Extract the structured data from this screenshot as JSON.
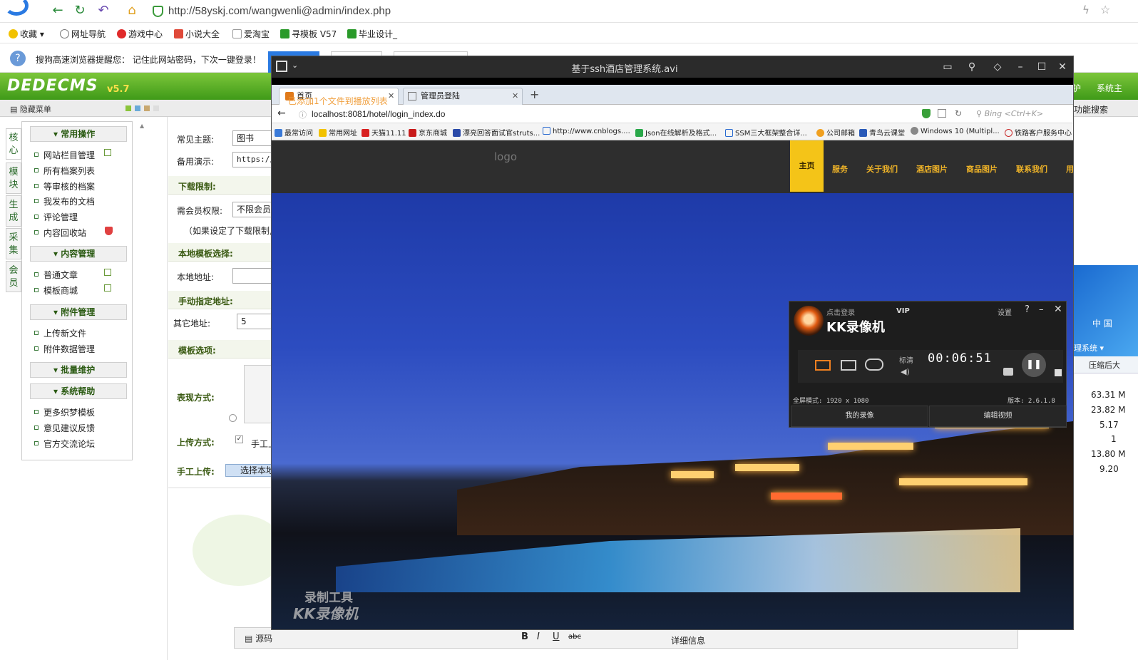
{
  "outer_browser": {
    "url": "http://58yskj.com/wangwenli@admin/index.php",
    "bookmarks": [
      "收藏",
      "网址导航",
      "游戏中心",
      "小说大全",
      "爱淘宝",
      "寻模板 V57",
      "毕业设计_"
    ],
    "notice": "搜狗高速浏览器提醒您：  记住此网站密码，下次一键登录！"
  },
  "dede": {
    "logo": "DEDECMS",
    "version": "v5.7",
    "hide_menu": "隐藏菜单",
    "left_tabs": [
      "核心",
      "模块",
      "生成",
      "采集",
      "会员"
    ],
    "menu_groups": [
      {
        "title": "常用操作",
        "items": [
          "网站栏目管理",
          "所有档案列表",
          "等审核的档案",
          "我发布的文档",
          "评论管理",
          "内容回收站"
        ]
      },
      {
        "title": "内容管理",
        "items": [
          "普通文章",
          "模板商城"
        ]
      },
      {
        "title": "附件管理",
        "items": [
          "上传新文件",
          "附件数据管理"
        ]
      },
      {
        "title": "批量维护",
        "items": []
      },
      {
        "title": "系统帮助",
        "items": [
          "更多织梦模板",
          "意见建议反馈",
          "官方交流论坛"
        ]
      }
    ],
    "form": {
      "theme_label": "常见主题:",
      "theme_value": "图书",
      "demo_label": "备用演示:",
      "demo_value": "https://",
      "download_section": "下载限制:",
      "member_label": "需会员权限:",
      "member_value": "不限会员",
      "download_note": "（如果设定了下载限制,",
      "local_section": "本地模板选择:",
      "local_label": "本地地址:",
      "manual_section": "手动指定地址:",
      "other_label": "其它地址:",
      "other_value": "5",
      "tpl_section": "模板选项:",
      "show_label": "表现方式:",
      "upload_label": "上传方式:",
      "upload_value": "手工上",
      "manual_upload_label": "手工上传:",
      "manual_upload_btn": "选择本地"
    },
    "right_edge": {
      "top_links": [
        "护",
        "系统主"
      ],
      "search": "功能搜索",
      "dropdown": "理系统",
      "col_header": "压缩后大",
      "values": [
        "63.31 M",
        "23.82 M",
        "5.17",
        "1",
        "13.80 M",
        "9.20"
      ],
      "blue_text": "中 国"
    },
    "editor": {
      "source_btn": "源码",
      "detail_tab": "详细信息"
    }
  },
  "kk_window": {
    "title": "基于ssh酒店管理系统.avi",
    "inner_tabs": [
      {
        "label": "首页",
        "overlay": "已添加1个文件到播放列表"
      },
      {
        "label": "管理员登陆"
      }
    ],
    "inner_url": "localhost:8081/hotel/login_index.do",
    "inner_search_placeholder": "Bing <Ctrl+K>",
    "inner_bookmarks": [
      "最常访问",
      "常用网址",
      "天猫11.11",
      "京东商城",
      "漂亮回答面试官struts...",
      "http://www.cnblogs....",
      "Json在线解析及格式...",
      "SSM三大框架整合详...",
      "公司邮箱",
      "青鸟云课堂",
      "Windows 10 (Multipl...",
      "铁路客户服务中心"
    ],
    "site": {
      "logo": "logo",
      "nav": [
        "主页",
        "服务",
        "关于我们",
        "酒店图片",
        "商品图片",
        "联系我们",
        "用"
      ]
    },
    "watermark": [
      "录制工具",
      "KK录像机"
    ]
  },
  "kk_recorder": {
    "login": "点击登录",
    "vip": "VIP",
    "settings": "设置",
    "brand": "KK录像机",
    "quality": "标清",
    "time": "00:06:51",
    "mode": "全屏模式: 1920 x 1080",
    "version": "版本: 2.6.1.8",
    "my_recordings": "我的录像",
    "edit_video": "编辑视频"
  }
}
